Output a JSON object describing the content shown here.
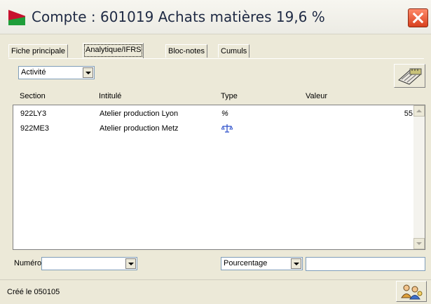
{
  "window": {
    "title": "Compte : 601019 Achats matières 19,6 %"
  },
  "tabs": [
    {
      "label": "Fiche principale"
    },
    {
      "label": "Analytique/IFRS"
    },
    {
      "label": "Bloc-notes"
    },
    {
      "label": "Cumuls"
    }
  ],
  "filter": {
    "selected": "Activité"
  },
  "columns": {
    "section": "Section",
    "intitule": "Intitulé",
    "type": "Type",
    "valeur": "Valeur"
  },
  "rows": [
    {
      "section": "922LY3",
      "intitule": "Atelier production Lyon",
      "type_symbol": "%",
      "valeur": "55"
    },
    {
      "section": "922ME3",
      "intitule": "Atelier production Metz",
      "type_icon": "balance-scale-icon",
      "valeur": ""
    }
  ],
  "footer": {
    "numero_label": "Numéro",
    "numero_value": "",
    "type_selected": "Pourcentage",
    "value_input": ""
  },
  "status": {
    "created": "Créé le 050105"
  },
  "colors": {
    "accent_blue": "#3355cc",
    "close_red": "#d8401e"
  }
}
